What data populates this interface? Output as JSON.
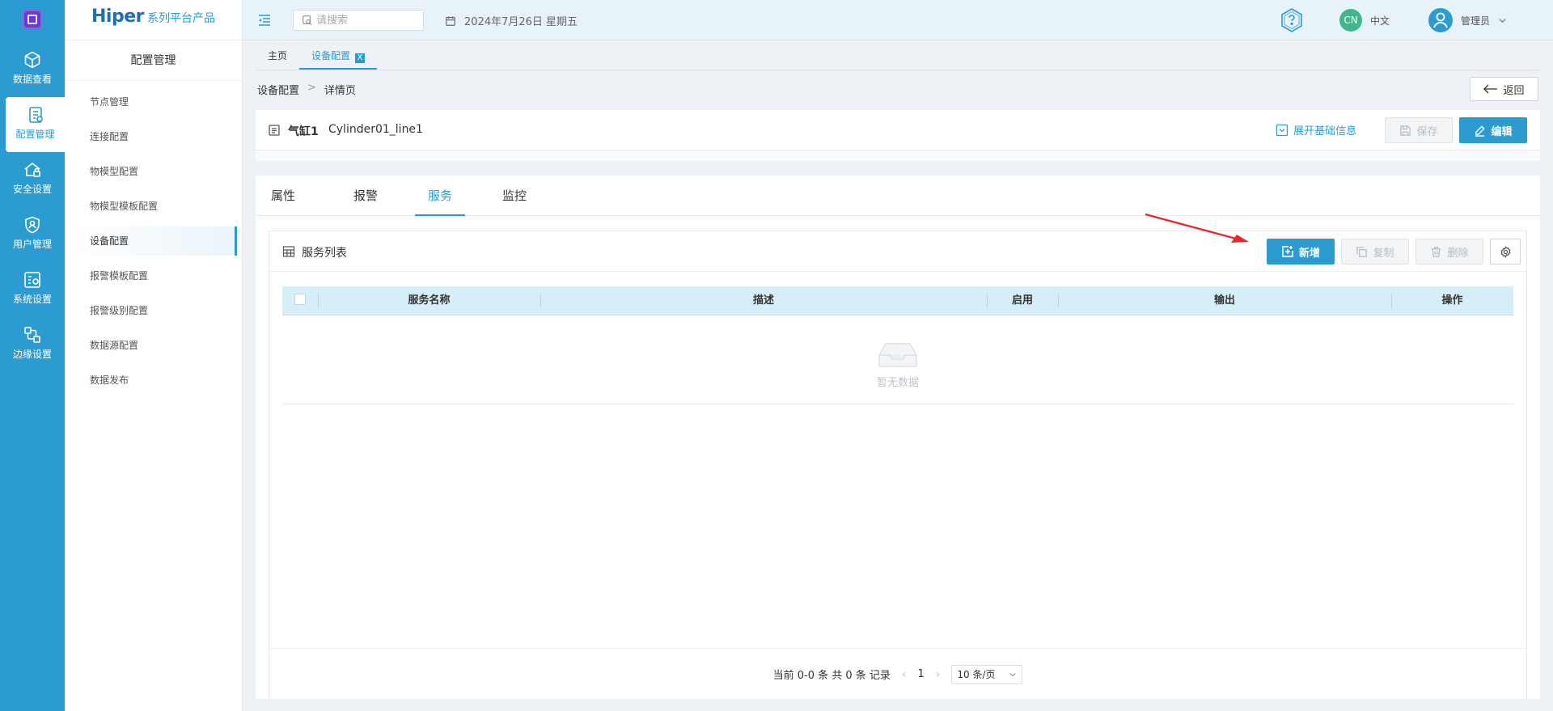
{
  "app": {
    "brand_main": "Hiper",
    "brand_sub": "系列平台产品"
  },
  "rail": {
    "items": [
      {
        "label": "数据查看",
        "icon": "cube-icon"
      },
      {
        "label": "配置管理",
        "icon": "config-icon",
        "active": true
      },
      {
        "label": "安全设置",
        "icon": "house-lock-icon"
      },
      {
        "label": "用户管理",
        "icon": "shield-user-icon"
      },
      {
        "label": "系统设置",
        "icon": "system-settings-icon"
      },
      {
        "label": "边缘设置",
        "icon": "edge-nodes-icon"
      }
    ]
  },
  "sidebar": {
    "section_title": "配置管理",
    "items": [
      {
        "label": "节点管理"
      },
      {
        "label": "连接配置"
      },
      {
        "label": "物模型配置"
      },
      {
        "label": "物模型模板配置"
      },
      {
        "label": "设备配置",
        "active": true
      },
      {
        "label": "报警模板配置"
      },
      {
        "label": "报警级别配置"
      },
      {
        "label": "数据源配置"
      },
      {
        "label": "数据发布"
      }
    ]
  },
  "header": {
    "search_placeholder": "请搜索",
    "date": "2024年7月26日 星期五",
    "lang_badge": "CN",
    "lang_label": "中文",
    "user_name": "管理员"
  },
  "tabs": [
    {
      "label": "主页"
    },
    {
      "label": "设备配置",
      "active": true,
      "close": "X"
    }
  ],
  "breadcrumb": {
    "items": [
      "设备配置",
      "详情页"
    ],
    "separator": ">"
  },
  "back_label": "返回",
  "device": {
    "name": "气缸1",
    "code": "Cylinder01_line1",
    "expand_label": "展开基础信息",
    "save_label": "保存",
    "edit_label": "编辑"
  },
  "subtabs": [
    {
      "label": "属性"
    },
    {
      "label": "报警"
    },
    {
      "label": "服务",
      "active": true
    },
    {
      "label": "监控"
    }
  ],
  "service_list": {
    "title": "服务列表",
    "add_label": "新增",
    "copy_label": "复制",
    "delete_label": "删除",
    "columns": [
      "服务名称",
      "描述",
      "启用",
      "输出",
      "操作"
    ],
    "rows": [],
    "empty_text": "暂无数据"
  },
  "pagination": {
    "summary": "当前 0-0 条 共 0 条 记录",
    "current_page": "1",
    "page_size": "10 条/页"
  },
  "colors": {
    "primary": "#2b9bd1",
    "rail_bg": "#2b9bd1",
    "header_bg": "#e7f3f9",
    "table_header_bg": "#d6eef8",
    "lang_badge": "#3fb78a",
    "annotation_arrow": "#e8262b"
  }
}
